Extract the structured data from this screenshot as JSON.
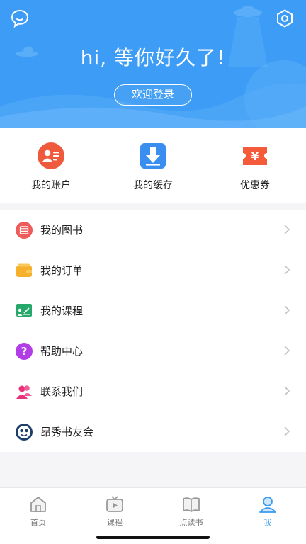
{
  "header": {
    "greeting": "hi, 等你好久了!",
    "login_label": "欢迎登录",
    "left_icon": "chat-bubble-icon",
    "right_icon": "settings-hexagon-icon",
    "bg_color": "#3d9cf5"
  },
  "quick_actions": [
    {
      "label": "我的账户",
      "icon": "account-card-icon",
      "color": "#f05a3c"
    },
    {
      "label": "我的缓存",
      "icon": "download-cache-icon",
      "color": "#3a8ef0"
    },
    {
      "label": "优惠券",
      "icon": "coupon-yen-icon",
      "color": "#f55a3a"
    }
  ],
  "menu": [
    {
      "label": "我的图书",
      "icon": "book-icon"
    },
    {
      "label": "我的订单",
      "icon": "wallet-icon"
    },
    {
      "label": "我的课程",
      "icon": "course-board-icon"
    },
    {
      "label": "帮助中心",
      "icon": "help-question-icon"
    },
    {
      "label": "联系我们",
      "icon": "contact-people-icon"
    },
    {
      "label": "昂秀书友会",
      "icon": "club-avatar-icon"
    }
  ],
  "tabs": [
    {
      "label": "首页",
      "icon": "home-icon",
      "active": false
    },
    {
      "label": "课程",
      "icon": "tv-icon",
      "active": false
    },
    {
      "label": "点读书",
      "icon": "open-book-icon",
      "active": false
    },
    {
      "label": "我",
      "icon": "user-icon",
      "active": true
    }
  ],
  "colors": {
    "accent": "#3a9bef"
  }
}
